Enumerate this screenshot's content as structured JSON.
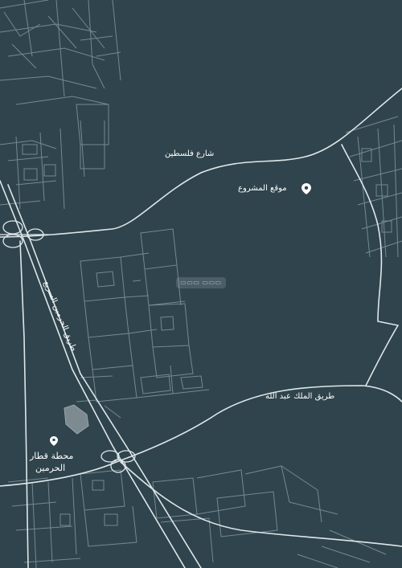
{
  "map": {
    "background_color": "#2f444c",
    "road_color": "#dfe7ea",
    "street_color": "#8da0a8",
    "station_color": "#7d8a90"
  },
  "labels": {
    "palestine_street": "شارع فلسطين",
    "project_location": "موقع المشروع",
    "haramain_road": "طريق الحرمين السريع",
    "king_abdullah_road": "طريق الملك عبد الله",
    "station_line1": "محطة قطار",
    "station_line2": "الحرمين"
  },
  "icons": {
    "project": "location-pin-icon",
    "station": "train-station-icon"
  }
}
